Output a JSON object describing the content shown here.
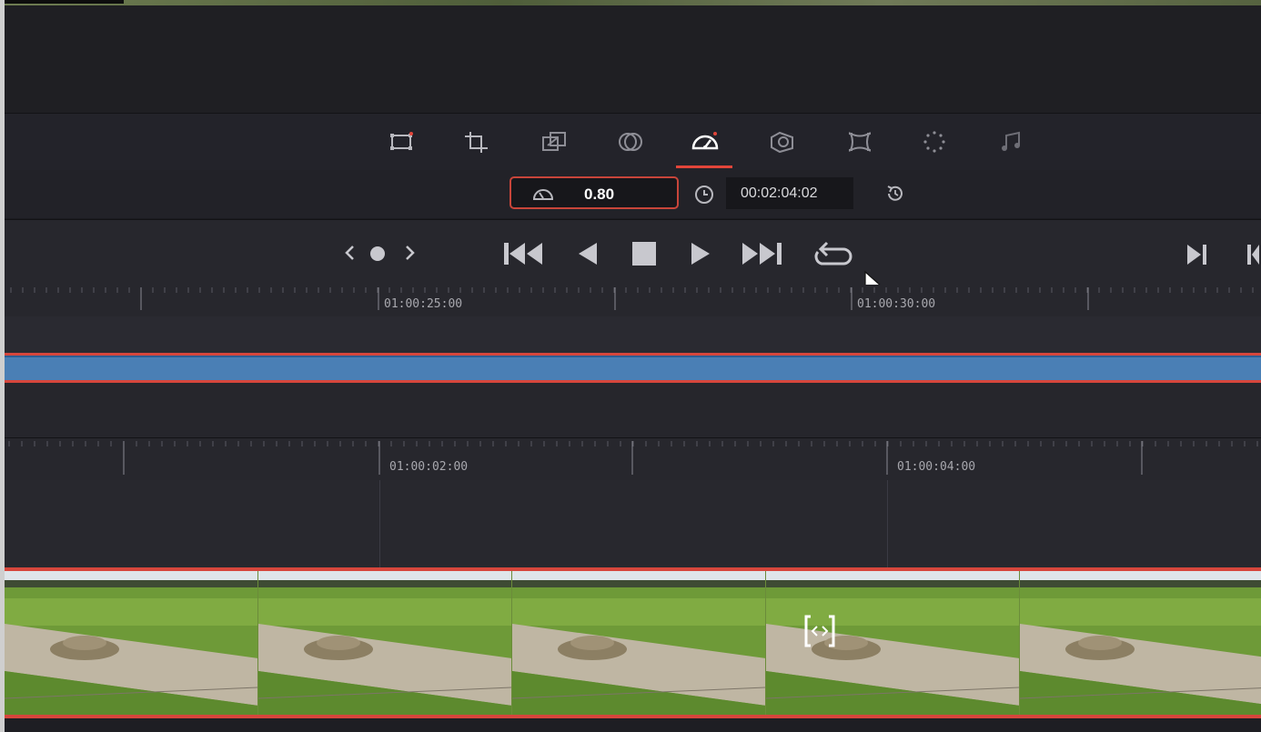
{
  "inspector": {
    "tabs": [
      {
        "name": "transform-icon",
        "modified": true
      },
      {
        "name": "crop-icon",
        "modified": false
      },
      {
        "name": "dynamic-zoom-icon",
        "modified": false
      },
      {
        "name": "composite-icon",
        "modified": false
      },
      {
        "name": "speed-change-icon",
        "modified": true,
        "active": true
      },
      {
        "name": "stabilization-icon",
        "modified": false
      },
      {
        "name": "lens-correction-icon",
        "modified": false
      },
      {
        "name": "retime-scaling-icon",
        "modified": false
      },
      {
        "name": "audio-icon",
        "modified": false
      }
    ],
    "speed_value": "0.80",
    "duration_timecode": "00:02:04:02"
  },
  "ruler_top": {
    "labels": [
      "01:00:25:00",
      "01:00:30:00"
    ]
  },
  "ruler_bottom": {
    "labels": [
      "01:00:02:00",
      "01:00:04:00"
    ]
  },
  "colors": {
    "accent_red": "#d6463c",
    "clip_blue": "#4a7fb5",
    "panel_dark": "#1f1f23"
  }
}
